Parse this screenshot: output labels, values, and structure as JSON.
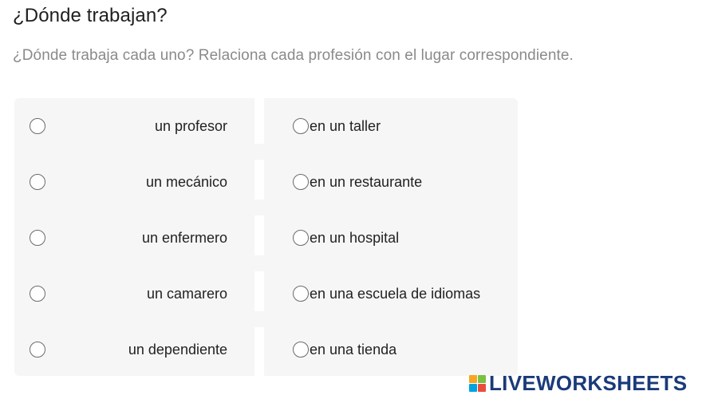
{
  "header": {
    "title": "¿Dónde trabajan?",
    "subtitle": "¿Dónde trabaja cada uno? Relaciona cada profesión con el lugar correspondiente."
  },
  "left_items": [
    {
      "label": "un profesor"
    },
    {
      "label": "un mecánico"
    },
    {
      "label": "un enfermero"
    },
    {
      "label": "un camarero"
    },
    {
      "label": "un dependiente"
    }
  ],
  "right_items": [
    {
      "label": "en un taller"
    },
    {
      "label": "en un restaurante"
    },
    {
      "label": "en un hospital"
    },
    {
      "label": "en una escuela de idiomas"
    },
    {
      "label": "en una tienda"
    }
  ],
  "brand": {
    "text": "LIVEWORKSHEETS",
    "icon_colors": [
      "#f5a623",
      "#7ac143",
      "#00a3e0",
      "#e94e3c"
    ],
    "text_color": "#1a3a7a"
  },
  "colors": {
    "panel_background": "#f6f6f6",
    "radio_border": "#6b6b6b"
  }
}
